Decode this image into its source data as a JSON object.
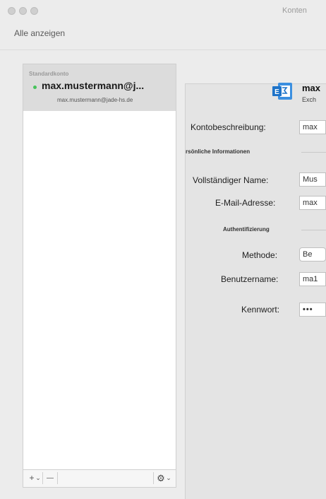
{
  "window": {
    "title": "Konten"
  },
  "toolbar": {
    "show_all_label": "Alle anzeigen"
  },
  "sidebar": {
    "group_header": "Standardkonto",
    "accounts": [
      {
        "name": "max.mustermann@j...",
        "email": "max.mustermann@jade-hs.de",
        "status_color": "#46c35a"
      }
    ],
    "add_label": "+",
    "add_menu_label": "⌄",
    "remove_label": "—",
    "settings_label": "⚙",
    "settings_menu_label": "⌄"
  },
  "detail": {
    "account_name": "max",
    "account_type": "Exch",
    "icon": "exchange-icon",
    "fields": {
      "description_label": "Kontobeschreibung:",
      "description_value": "max",
      "personal_section": "rsönliche Informationen",
      "fullname_label": "Vollständiger Name:",
      "fullname_value": "Mus",
      "email_label": "E-Mail-Adresse:",
      "email_value": "max",
      "auth_section": "Authentifizierung",
      "method_label": "Methode:",
      "method_value": "Be",
      "username_label": "Benutzername:",
      "username_value": "ma1",
      "password_label": "Kennwort:",
      "password_value": "•••"
    }
  },
  "colors": {
    "background": "#ececec",
    "selected_row": "#dcdcdc",
    "accent_blue": "#1e73c8"
  }
}
